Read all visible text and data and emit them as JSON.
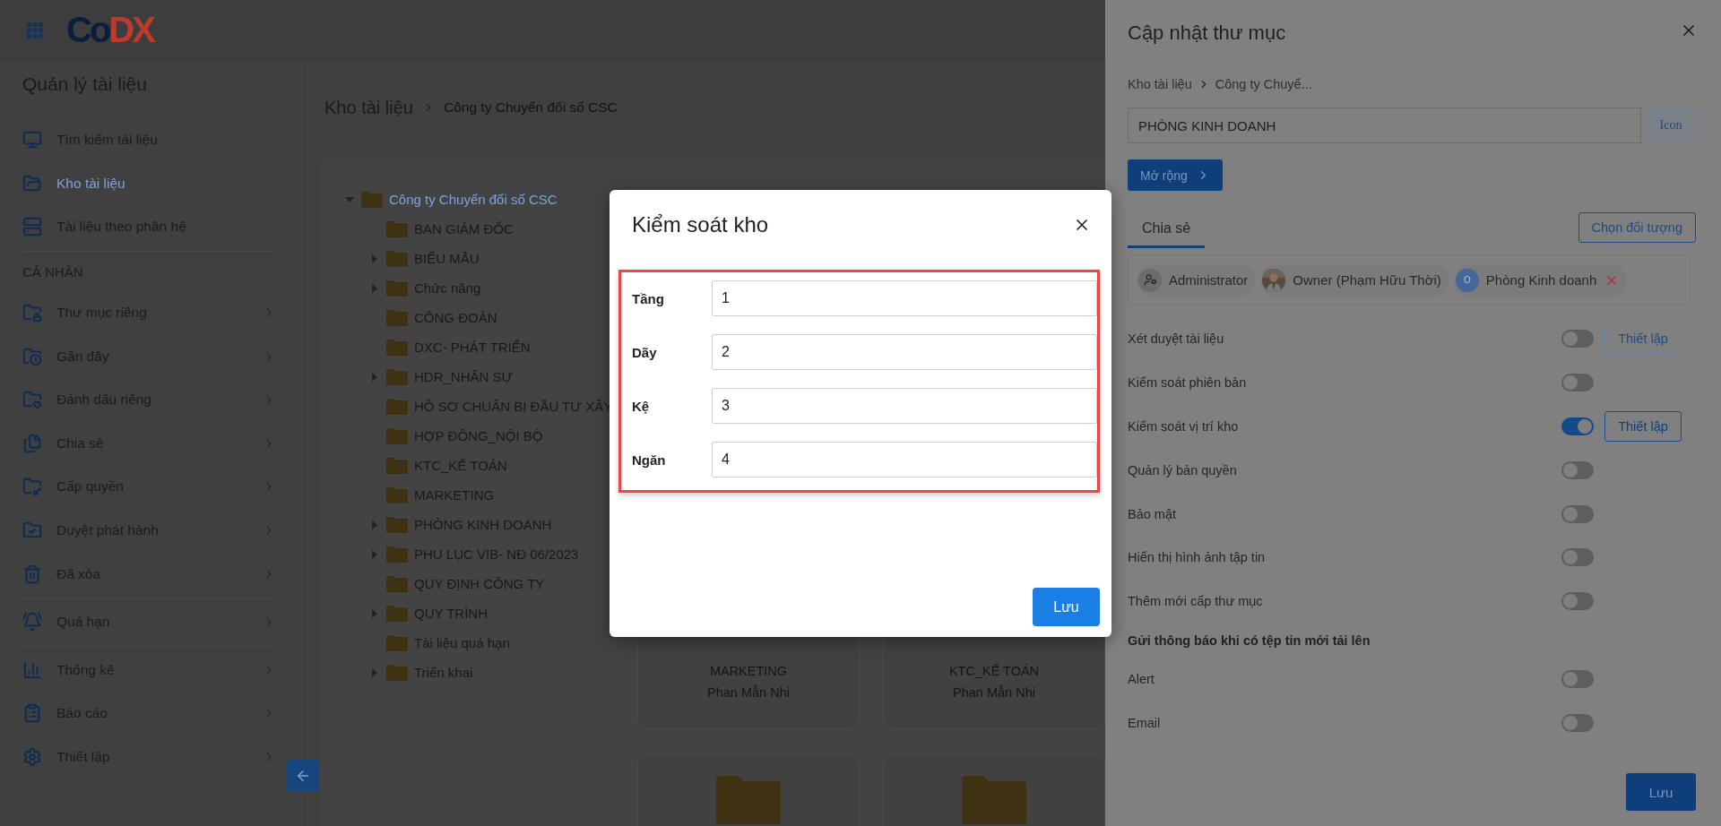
{
  "app": {
    "logo": "CoDX"
  },
  "sidebar": {
    "title": "Quản lý tài liệu",
    "sections": [
      {
        "items": [
          {
            "label": "Tìm kiếm tài liệu",
            "selected": false,
            "has_submenu": false
          },
          {
            "label": "Kho tài liệu",
            "selected": true,
            "has_submenu": false
          },
          {
            "label": "Tài liệu theo phân hệ",
            "selected": false,
            "has_submenu": false
          }
        ]
      },
      {
        "heading": "CÁ NHÂN",
        "items": [
          {
            "label": "Thư mục riêng",
            "selected": false,
            "has_submenu": true
          },
          {
            "label": "Gần đây",
            "selected": false,
            "has_submenu": true
          },
          {
            "label": "Đánh dấu riêng",
            "selected": false,
            "has_submenu": true
          },
          {
            "label": "Chia sẻ",
            "selected": false,
            "has_submenu": true
          },
          {
            "label": "Cấp quyền",
            "selected": false,
            "has_submenu": true
          },
          {
            "label": "Duyệt phát hành",
            "selected": false,
            "has_submenu": true
          },
          {
            "label": "Đã xóa",
            "selected": false,
            "has_submenu": true
          }
        ]
      },
      {
        "items": [
          {
            "label": "Quá hạn",
            "selected": false,
            "has_submenu": true
          }
        ]
      },
      {
        "items": [
          {
            "label": "Thống kê",
            "selected": false,
            "has_submenu": true
          },
          {
            "label": "Báo cáo",
            "selected": false,
            "has_submenu": true
          },
          {
            "label": "Thiết lập",
            "selected": false,
            "has_submenu": true
          }
        ]
      }
    ]
  },
  "breadcrumb": [
    "Kho tài liệu",
    "Công ty Chuyển đổi số CSC"
  ],
  "tree": {
    "label": "Công ty Chuyển đổi số CSC",
    "selected": true,
    "expanded": true,
    "children": [
      {
        "label": "BAN GIÁM ĐỐC",
        "selected": false,
        "has_children": false
      },
      {
        "label": "BIỂU MẪU",
        "selected": false,
        "has_children": true
      },
      {
        "label": "Chức năng",
        "selected": false,
        "has_children": true
      },
      {
        "label": "CÔNG ĐOÀN",
        "selected": false,
        "has_children": false
      },
      {
        "label": "DXC- PHÁT TRIỂN",
        "selected": false,
        "has_children": false
      },
      {
        "label": "HDR_NHÂN SỰ",
        "selected": false,
        "has_children": true
      },
      {
        "label": "HỒ SƠ CHUẨN BỊ ĐẦU TƯ XÂY",
        "selected": false,
        "has_children": false
      },
      {
        "label": "HỢP ĐỒNG_NỘI BỘ",
        "selected": false,
        "has_children": false
      },
      {
        "label": "KTC_KẾ TOÁN",
        "selected": false,
        "has_children": false
      },
      {
        "label": "MARKETING",
        "selected": false,
        "has_children": false
      },
      {
        "label": "PHÒNG KINH DOANH",
        "selected": false,
        "has_children": true
      },
      {
        "label": "PHỤ LỤC VIB- NĐ 06/2023",
        "selected": false,
        "has_children": true
      },
      {
        "label": "QUY ĐỊNH CÔNG TY",
        "selected": false,
        "has_children": false
      },
      {
        "label": "QUY TRÌNH",
        "selected": false,
        "has_children": true
      },
      {
        "label": "Tài liệu quá hạn",
        "selected": false,
        "has_children": false
      },
      {
        "label": "Triển khai",
        "selected": false,
        "has_children": true
      }
    ]
  },
  "cards": [
    {
      "kind": "named",
      "title": "MARKETING",
      "owner": "Phan Mẫn Nhi"
    },
    {
      "kind": "named",
      "title": "KTC_KẾ TOÁN",
      "owner": "Phan Mẫn Nhi"
    },
    {
      "kind": "folder"
    },
    {
      "kind": "folder"
    }
  ],
  "panel": {
    "title": "Cập nhật thư mục",
    "breadcrumb": [
      "Kho tài liệu",
      "Công ty Chuyể..."
    ],
    "name_value": "PHÒNG KINH DOANH",
    "icon_button": "Icon",
    "expand_button": "Mở rộng",
    "tabs": [
      {
        "label": "Chia sẻ",
        "selected": true
      }
    ],
    "choose_button": "Chọn đối tượng",
    "shares": [
      {
        "kind": "role",
        "label": "Administrator",
        "removable": false
      },
      {
        "label": "Owner (Phạm Hữu Thời)",
        "removable": false
      },
      {
        "kind": "initial",
        "initial": "O",
        "label": "Phòng Kinh doanh",
        "removable": true
      }
    ],
    "settings": [
      {
        "kind": "toggle",
        "label": "Xét duyệt tài liệu",
        "on": false,
        "setup": {
          "label": "Thiết lập",
          "disabled": true
        }
      },
      {
        "kind": "toggle",
        "label": "Kiểm soát phiên bản",
        "on": false
      },
      {
        "kind": "toggle",
        "label": "Kiểm soát vị trí kho",
        "on": true,
        "setup": {
          "label": "Thiết lập",
          "disabled": false
        }
      },
      {
        "kind": "toggle",
        "label": "Quản lý bản quyền",
        "on": false
      },
      {
        "kind": "toggle",
        "label": "Bảo mật",
        "on": false
      },
      {
        "kind": "toggle",
        "label": "Hiển thị hình ảnh tập tin",
        "on": false
      },
      {
        "kind": "toggle",
        "label": "Thêm mới cấp thư mục",
        "on": false
      },
      {
        "kind": "heading",
        "label": "Gửi thông báo khi có tệp tin mới tải lên"
      },
      {
        "kind": "toggle",
        "label": "Alert",
        "on": false
      },
      {
        "kind": "toggle",
        "label": "Email",
        "on": false
      }
    ],
    "save_button": "Lưu"
  },
  "modal": {
    "title": "Kiểm soát kho",
    "highlighted": true,
    "fields": [
      {
        "label": "Tầng",
        "value": "1"
      },
      {
        "label": "Dãy",
        "value": "2"
      },
      {
        "label": "Kệ",
        "value": "3"
      },
      {
        "label": "Ngăn",
        "value": "4"
      }
    ],
    "save_button": "Lưu"
  }
}
